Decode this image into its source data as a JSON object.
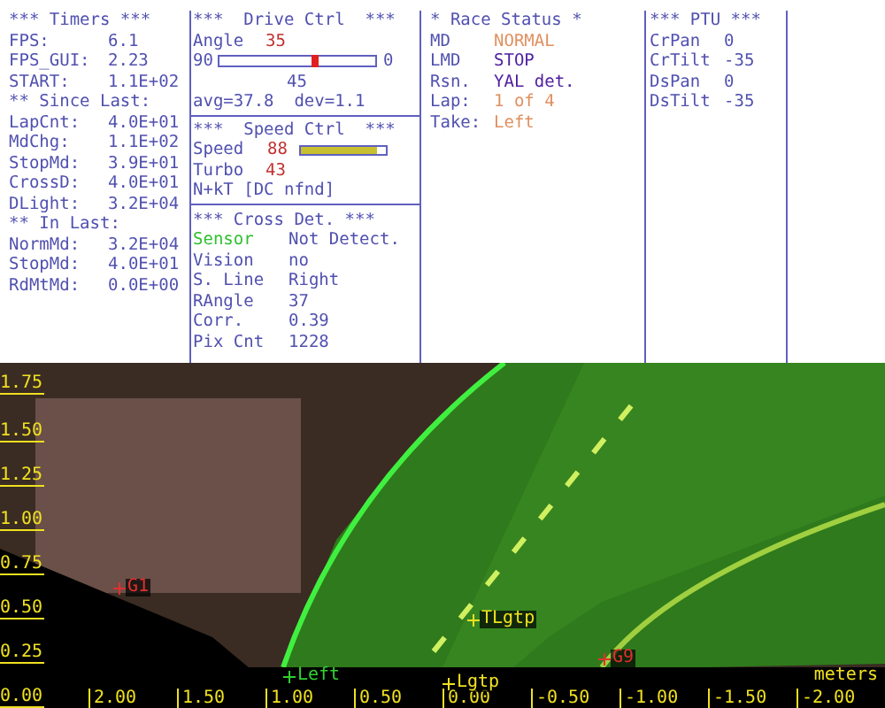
{
  "timers": {
    "lines": [
      {
        "kind": "heading",
        "label": "*** Timers ***"
      },
      {
        "kind": "row",
        "label": "FPS:",
        "value": "6.1"
      },
      {
        "kind": "row",
        "label": "FPS_GUI:",
        "value": "2.23"
      },
      {
        "kind": "row",
        "label": "START:",
        "value": "1.1E+02"
      },
      {
        "kind": "heading",
        "label": "** Since Last:"
      },
      {
        "kind": "row",
        "label": "LapCnt:",
        "value": "4.0E+01"
      },
      {
        "kind": "row",
        "label": "MdChg:",
        "value": "1.1E+02"
      },
      {
        "kind": "row",
        "label": "StopMd:",
        "value": "3.9E+01"
      },
      {
        "kind": "row",
        "label": "CrossD:",
        "value": "4.0E+01"
      },
      {
        "kind": "row",
        "label": "DLight:",
        "value": "3.2E+04"
      },
      {
        "kind": "heading",
        "label": "** In Last:"
      },
      {
        "kind": "row",
        "label": "NormMd:",
        "value": "3.2E+04"
      },
      {
        "kind": "row",
        "label": "StopMd:",
        "value": "4.0E+01"
      },
      {
        "kind": "row",
        "label": "RdMtMd:",
        "value": "0.0E+00"
      }
    ]
  },
  "drive_ctrl": {
    "title": "***  Drive Ctrl  ***",
    "angle_label": "Angle",
    "angle_value": "35",
    "slider": {
      "min_label": "90",
      "max_label": "0",
      "mid_label": "45",
      "level": 0.61
    },
    "stats": "avg=37.8  dev=1.1"
  },
  "speed_ctrl": {
    "title": "***  Speed Ctrl  ***",
    "speed_label": "Speed",
    "speed_value": "88",
    "speed_bar": {
      "level": 0.9
    },
    "turbo_label": "Turbo",
    "turbo_value": "43",
    "mode": "N+kT [DC nfnd]"
  },
  "cross_det": {
    "title": "*** Cross Det. ***",
    "rows": [
      {
        "label": "Sensor",
        "value": "Not Detect.",
        "color": "#30c030"
      },
      {
        "label": "Vision",
        "value": "no",
        "color": "#5050b0"
      },
      {
        "label": "S. Line",
        "value": "Right",
        "color": "#5050b0"
      },
      {
        "label": "RAngle",
        "value": "37",
        "color": "#5050b0"
      },
      {
        "label": "Corr.",
        "value": "0.39",
        "color": "#5050b0"
      },
      {
        "label": "Pix Cnt",
        "value": "1228",
        "color": "#5050b0"
      }
    ]
  },
  "race_status": {
    "title": "* Race Status *",
    "rows": [
      {
        "label": "MD",
        "value": "NORMAL",
        "color": "#e09060"
      },
      {
        "label": "LMD",
        "value": "STOP",
        "color": "#5020a0"
      },
      {
        "label": "Rsn.",
        "value": "YAL det.",
        "color": "#5020a0"
      },
      {
        "label": "Lap:",
        "value": "1 of 4",
        "color": "#e09060"
      },
      {
        "label": "Take:",
        "value": "Left",
        "color": "#e09060"
      }
    ]
  },
  "ptu": {
    "title": "*** PTU ***",
    "rows": [
      {
        "label": "CrPan",
        "value": "0"
      },
      {
        "label": "CrTilt",
        "value": "-35"
      },
      {
        "label": "DsPan",
        "value": "0"
      },
      {
        "label": "DsTilt",
        "value": "-35"
      }
    ]
  },
  "camera": {
    "y_ticks": [
      "1.75",
      "1.50",
      "1.25",
      "1.00",
      "0.75",
      "0.50",
      "0.25",
      "0.00"
    ],
    "x_ticks": [
      "2.00",
      "1.50",
      "1.00",
      "0.50",
      "0.00",
      "-0.50",
      "-1.00",
      "-1.50",
      "-2.00"
    ],
    "unit": "meters",
    "markers": [
      {
        "label": "G1",
        "color": "#e03030"
      },
      {
        "label": "Left",
        "color": "#30d030"
      },
      {
        "label": "G9",
        "color": "#e03030"
      },
      {
        "label": "TLgtp",
        "color": "#f0e020"
      },
      {
        "label": "Lgtp",
        "color": "#f0e020"
      }
    ]
  }
}
